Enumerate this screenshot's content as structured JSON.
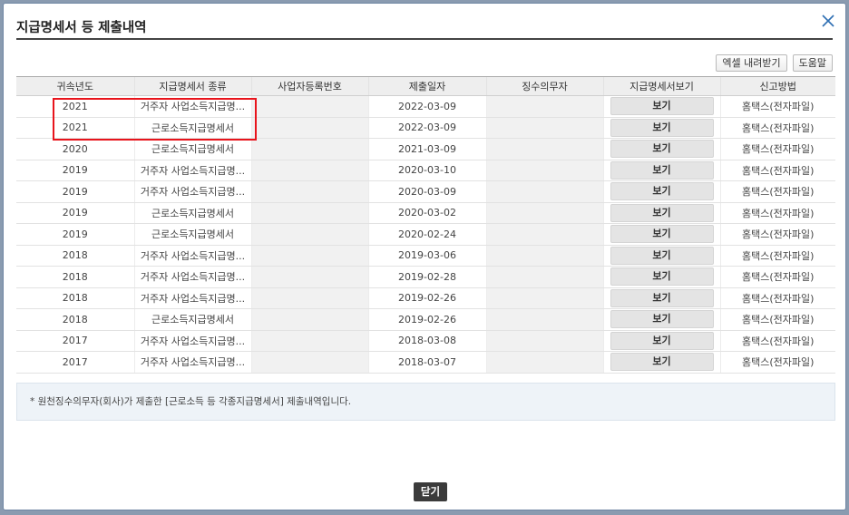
{
  "dialog": {
    "title": "지급명세서 등 제출내역",
    "close_icon": "close-icon"
  },
  "toolbar": {
    "excel_label": "엑셀 내려받기",
    "help_label": "도움말"
  },
  "table": {
    "headers": [
      "귀속년도",
      "지급명세서 종류",
      "사업자등록번호",
      "제출일자",
      "징수의무자",
      "지급명세서보기",
      "신고방법"
    ],
    "rows": [
      {
        "year": "2021",
        "kind": "거주자 사업소득지급명...",
        "date": "2022-03-09",
        "view": "보기",
        "method": "홈택스(전자파일)"
      },
      {
        "year": "2021",
        "kind": "근로소득지급명세서",
        "date": "2022-03-09",
        "view": "보기",
        "method": "홈택스(전자파일)"
      },
      {
        "year": "2020",
        "kind": "근로소득지급명세서",
        "date": "2021-03-09",
        "view": "보기",
        "method": "홈택스(전자파일)"
      },
      {
        "year": "2019",
        "kind": "거주자 사업소득지급명...",
        "date": "2020-03-10",
        "view": "보기",
        "method": "홈택스(전자파일)"
      },
      {
        "year": "2019",
        "kind": "거주자 사업소득지급명...",
        "date": "2020-03-09",
        "view": "보기",
        "method": "홈택스(전자파일)"
      },
      {
        "year": "2019",
        "kind": "근로소득지급명세서",
        "date": "2020-03-02",
        "view": "보기",
        "method": "홈택스(전자파일)"
      },
      {
        "year": "2019",
        "kind": "근로소득지급명세서",
        "date": "2020-02-24",
        "view": "보기",
        "method": "홈택스(전자파일)"
      },
      {
        "year": "2018",
        "kind": "거주자 사업소득지급명...",
        "date": "2019-03-06",
        "view": "보기",
        "method": "홈택스(전자파일)"
      },
      {
        "year": "2018",
        "kind": "거주자 사업소득지급명...",
        "date": "2019-02-28",
        "view": "보기",
        "method": "홈택스(전자파일)"
      },
      {
        "year": "2018",
        "kind": "거주자 사업소득지급명...",
        "date": "2019-02-26",
        "view": "보기",
        "method": "홈택스(전자파일)"
      },
      {
        "year": "2018",
        "kind": "근로소득지급명세서",
        "date": "2019-02-26",
        "view": "보기",
        "method": "홈택스(전자파일)"
      },
      {
        "year": "2017",
        "kind": "거주자 사업소득지급명...",
        "date": "2018-03-08",
        "view": "보기",
        "method": "홈택스(전자파일)"
      },
      {
        "year": "2017",
        "kind": "거주자 사업소득지급명...",
        "date": "2018-03-07",
        "view": "보기",
        "method": "홈택스(전자파일)"
      }
    ]
  },
  "note": "* 원천징수의무자(회사)가 제출한 [근로소득 등 각종지급명세서] 제출내역입니다.",
  "footer": {
    "close_label": "닫기"
  },
  "colors": {
    "highlight": "#e8141c",
    "close_button_bg": "#3b3b3b",
    "note_bg": "#eef3f8"
  }
}
